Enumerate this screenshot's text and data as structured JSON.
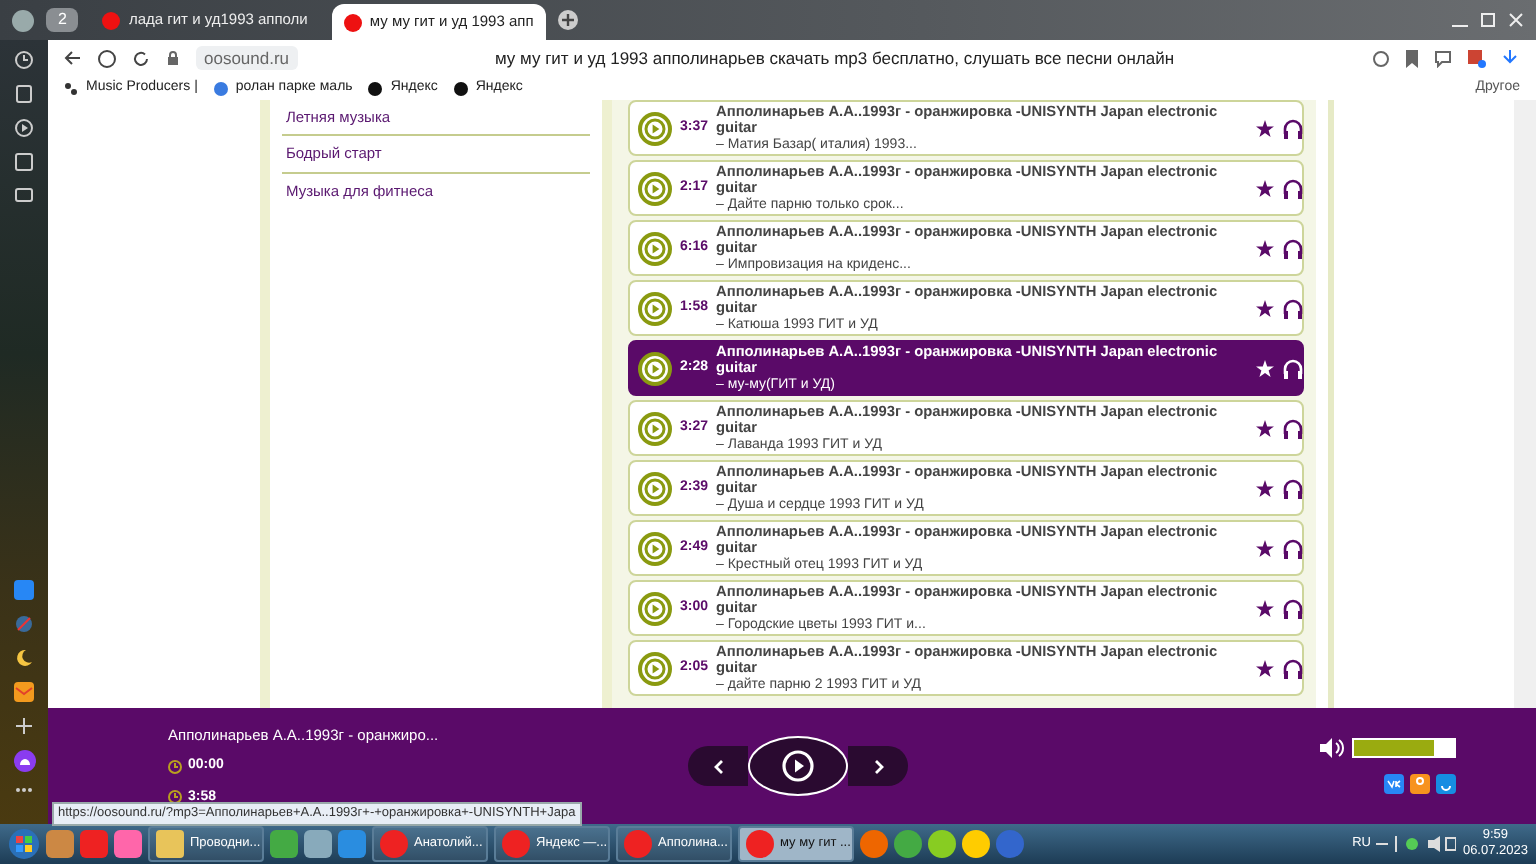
{
  "browser": {
    "tab_count": "2",
    "tabs": [
      {
        "title": "лада гит и уд1993 апполи",
        "selected": false
      },
      {
        "title": "му му гит и уд 1993 апп",
        "selected": true
      }
    ],
    "address": "oosound.ru",
    "page_title": "му му гит и уд 1993 апполинарьев скачать mp3 бесплатно, слушать все песни онлайн",
    "bookmarks": [
      "Music Producers |",
      "ролан парке маль",
      "Яндекс",
      "Яндекс"
    ],
    "other_bookmarks": "Другое"
  },
  "side_menu": [
    "Летняя музыка",
    "Бодрый старт",
    "Музыка для фитнеса"
  ],
  "tracks": [
    {
      "duration": "3:37",
      "title": "Апполинарьев А.А..1993г - оранжировка -UNISYNTH Japan electronic guitar",
      "subtitle": "– Матия Базар( италия) 1993...",
      "selected": false
    },
    {
      "duration": "2:17",
      "title": "Апполинарьев А.А..1993г - оранжировка -UNISYNTH Japan electronic guitar",
      "subtitle": "– Дайте парню только срок...",
      "selected": false
    },
    {
      "duration": "6:16",
      "title": "Апполинарьев А.А..1993г - оранжировка -UNISYNTH Japan electronic guitar",
      "subtitle": "– Импровизация на криденс...",
      "selected": false
    },
    {
      "duration": "1:58",
      "title": "Апполинарьев А.А..1993г - оранжировка -UNISYNTH Japan electronic guitar",
      "subtitle": "– Катюша 1993 ГИТ и УД",
      "selected": false
    },
    {
      "duration": "2:28",
      "title": "Апполинарьев А.А..1993г - оранжировка -UNISYNTH Japan electronic guitar",
      "subtitle": "– му-му(ГИТ и УД)",
      "selected": true
    },
    {
      "duration": "3:27",
      "title": "Апполинарьев А.А..1993г - оранжировка -UNISYNTH Japan electronic guitar",
      "subtitle": "– Лаванда 1993 ГИТ и УД",
      "selected": false
    },
    {
      "duration": "2:39",
      "title": "Апполинарьев А.А..1993г - оранжировка -UNISYNTH Japan electronic guitar",
      "subtitle": "– Душа и сердце 1993 ГИТ и УД",
      "selected": false
    },
    {
      "duration": "2:49",
      "title": "Апполинарьев А.А..1993г - оранжировка -UNISYNTH Japan electronic guitar",
      "subtitle": "– Крестный отец 1993 ГИТ и УД",
      "selected": false
    },
    {
      "duration": "3:00",
      "title": "Апполинарьев А.А..1993г - оранжировка -UNISYNTH Japan electronic guitar",
      "subtitle": "– Городские цветы 1993 ГИТ и...",
      "selected": false
    },
    {
      "duration": "2:05",
      "title": "Апполинарьев А.А..1993г - оранжировка -UNISYNTH Japan electronic guitar",
      "subtitle": "– дайте парню 2 1993 ГИТ и УД",
      "selected": false
    }
  ],
  "player": {
    "now_playing": "Апполинарьев А.А..1993г - оранжиро...",
    "elapsed": "00:00",
    "total": "3:58",
    "volume": {
      "level": 0.8
    }
  },
  "status_url": "https://oosound.ru/?mp3=Апполинарьев+А.А..1993г+-+оранжировка+-UNISYNTH+Japa",
  "taskbar": {
    "windows": [
      {
        "label": "Проводни...",
        "selected": false
      },
      {
        "label": "Анатолий...",
        "selected": false
      },
      {
        "label": "Яндекс —...",
        "selected": false
      },
      {
        "label": "Апполина...",
        "selected": false
      },
      {
        "label": "му му гит ...",
        "selected": true
      }
    ],
    "language": "RU",
    "time": "9:59",
    "date": "06.07.2023"
  }
}
